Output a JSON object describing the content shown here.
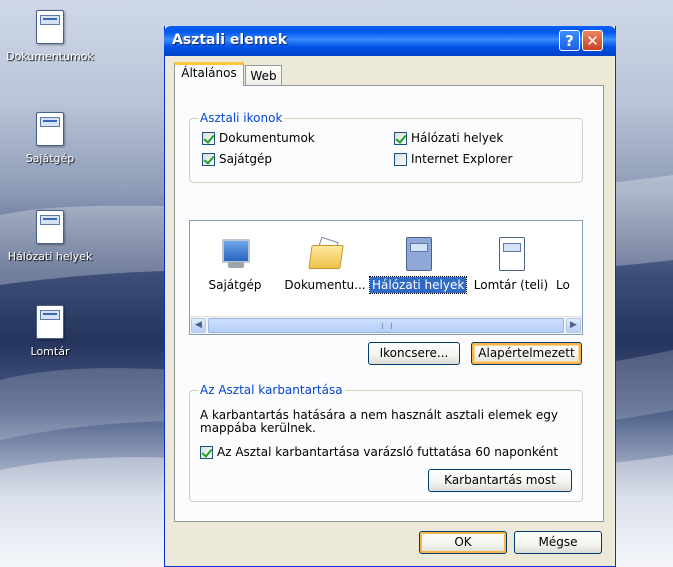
{
  "desktop": {
    "icons": [
      {
        "label": "Dokumentumok"
      },
      {
        "label": "Sajátgép"
      },
      {
        "label": "Hálózati helyek"
      },
      {
        "label": "Lomtár"
      }
    ]
  },
  "dialog": {
    "title": "Asztali elemek",
    "help_button": "?",
    "close_button": "✕",
    "tabs": [
      {
        "label": "Általános",
        "active": true
      },
      {
        "label": "Web",
        "active": false
      }
    ],
    "desktop_icons_group": {
      "legend": "Asztali ikonok",
      "checkboxes": [
        {
          "label": "Dokumentumok",
          "checked": true
        },
        {
          "label": "Hálózati helyek",
          "checked": true
        },
        {
          "label": "Sajátgép",
          "checked": true
        },
        {
          "label": "Internet Explorer",
          "checked": false
        }
      ]
    },
    "icon_list": {
      "items": [
        {
          "label": "Sajátgép",
          "icon": "computer-icon",
          "selected": false
        },
        {
          "label": "Dokumentu...",
          "icon": "folder-icon",
          "selected": false
        },
        {
          "label": "Hálózati helyek",
          "icon": "document-icon",
          "selected": true
        },
        {
          "label": "Lomtár (teli)",
          "icon": "document-icon",
          "selected": false
        },
        {
          "label": "Lo",
          "icon": "document-icon",
          "selected": false
        }
      ]
    },
    "buttons": {
      "change_icon": "Ikoncsere...",
      "default": "Alapértelmezett",
      "cleanup_now": "Karbantartás most",
      "ok": "OK",
      "cancel": "Mégse"
    },
    "cleanup_group": {
      "legend": "Az Asztal karbantartása",
      "description_line1": "A karbantartás hatására a nem használt asztali elemek egy",
      "description_line2": "mappába kerülnek.",
      "checkbox_label": "Az Asztal karbantartása varázsló futtatása 60 naponként",
      "checkbox_checked": true
    }
  },
  "colors": {
    "title_bar": "#0058ee",
    "accent": "#316ac5",
    "legend": "#0046d5",
    "tab_highlight": "#ffc83c"
  }
}
